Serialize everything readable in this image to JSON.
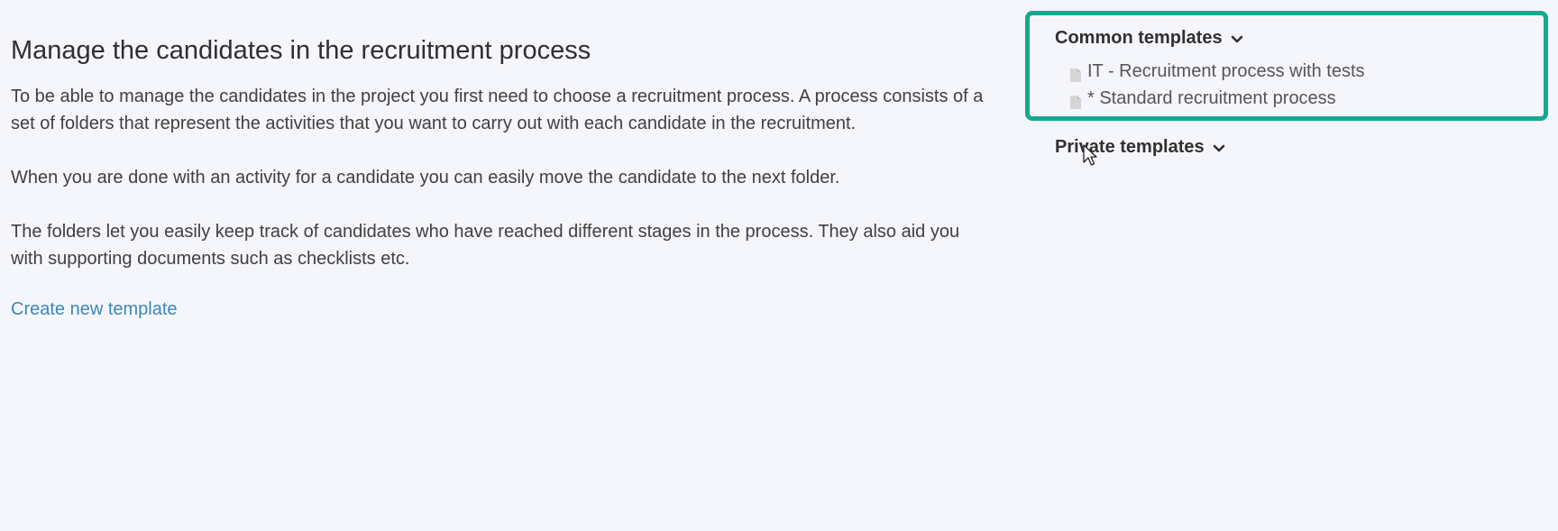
{
  "main": {
    "title": "Manage the candidates in the recruitment process",
    "paragraphs": [
      "To be able to manage the candidates in the project you first need to choose a recruitment process. A process consists of a set of folders that represent the activities that you want to carry out with each candidate in the recruitment.",
      "When you are done with an activity for a candidate you can easily move the candidate to the next folder.",
      "The folders let you easily keep track of candidates who have reached different stages in the process. They also aid you with supporting documents such as checklists etc."
    ],
    "create_link": "Create new template"
  },
  "sidebar": {
    "common": {
      "header": "Common templates",
      "items": [
        {
          "label": "IT - Recruitment process with tests",
          "icon": "document-icon"
        },
        {
          "label": "* Standard recruitment process",
          "icon": "document-icon"
        }
      ]
    },
    "private": {
      "header": "Private templates"
    }
  },
  "colors": {
    "background": "#f5f6fb",
    "highlight_border": "#16a88f",
    "link": "#3d86b8"
  }
}
